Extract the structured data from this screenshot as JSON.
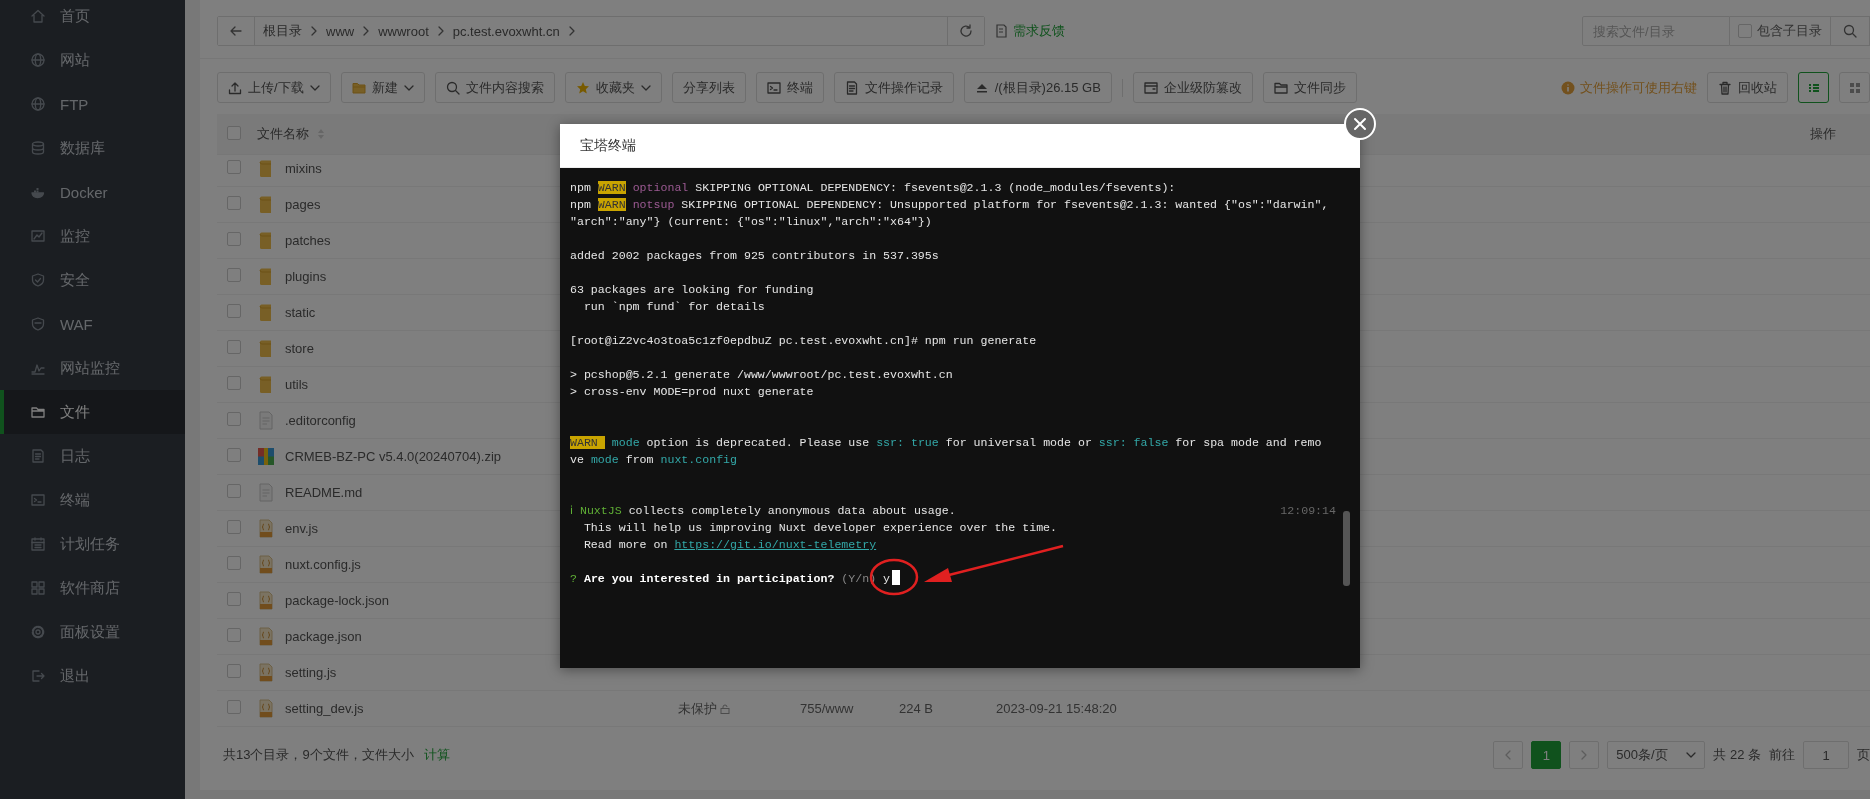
{
  "sidebar": {
    "items": [
      {
        "label": "首页",
        "selected": false
      },
      {
        "label": "网站",
        "selected": false
      },
      {
        "label": "FTP",
        "selected": false
      },
      {
        "label": "数据库",
        "selected": false
      },
      {
        "label": "Docker",
        "selected": false
      },
      {
        "label": "监控",
        "selected": false
      },
      {
        "label": "安全",
        "selected": false
      },
      {
        "label": "WAF",
        "selected": false
      },
      {
        "label": "网站监控",
        "selected": false
      },
      {
        "label": "文件",
        "selected": true
      },
      {
        "label": "日志",
        "selected": false
      },
      {
        "label": "终端",
        "selected": false
      },
      {
        "label": "计划任务",
        "selected": false
      },
      {
        "label": "软件商店",
        "selected": false
      },
      {
        "label": "面板设置",
        "selected": false
      },
      {
        "label": "退出",
        "selected": false
      }
    ]
  },
  "breadcrumb": {
    "items": [
      "根目录",
      "www",
      "wwwroot",
      "pc.test.evoxwht.cn"
    ],
    "feedback": "需求反馈"
  },
  "search": {
    "placeholder": "搜索文件/目录",
    "subdir_label": "包含子目录",
    "subdir_checked": false
  },
  "toolbar": {
    "buttons": [
      {
        "label": "上传/下载",
        "kind": "dropdown"
      },
      {
        "label": "新建",
        "kind": "dropdown"
      },
      {
        "label": "文件内容搜索",
        "kind": "plain"
      },
      {
        "label": "收藏夹",
        "kind": "dropdown"
      },
      {
        "label": "分享列表",
        "kind": "plain"
      },
      {
        "label": "终端",
        "kind": "plain"
      },
      {
        "label": "文件操作记录",
        "kind": "plain"
      },
      {
        "label": "/(根目录)26.15 GB",
        "kind": "disk"
      },
      {
        "label": "企业级防篡改",
        "kind": "plain"
      },
      {
        "label": "文件同步",
        "kind": "plain"
      }
    ],
    "hint": "文件操作可使用右键",
    "recycle": "回收站",
    "views": [
      {
        "selected": true
      },
      {
        "selected": false
      }
    ]
  },
  "table": {
    "columns": [
      "文件名称",
      "操作"
    ],
    "header_checked": false,
    "rows": [
      {
        "name": "mixins",
        "kind": "folder",
        "checked": false
      },
      {
        "name": "pages",
        "kind": "folder",
        "checked": false
      },
      {
        "name": "patches",
        "kind": "folder",
        "checked": false
      },
      {
        "name": "plugins",
        "kind": "folder",
        "checked": false
      },
      {
        "name": "static",
        "kind": "folder",
        "checked": false
      },
      {
        "name": "store",
        "kind": "folder",
        "checked": false
      },
      {
        "name": "utils",
        "kind": "folder",
        "checked": false
      },
      {
        "name": ".editorconfig",
        "kind": "file",
        "checked": false
      },
      {
        "name": "CRMEB-BZ-PC v5.4.0(20240704).zip",
        "kind": "archive",
        "checked": false
      },
      {
        "name": "README.md",
        "kind": "file",
        "checked": false
      },
      {
        "name": "env.js",
        "kind": "script",
        "checked": false
      },
      {
        "name": "nuxt.config.js",
        "kind": "script",
        "checked": false
      },
      {
        "name": "package-lock.json",
        "kind": "script",
        "checked": false
      },
      {
        "name": "package.json",
        "kind": "script",
        "checked": false
      },
      {
        "name": "setting.js",
        "kind": "script",
        "checked": false
      },
      {
        "name": "setting_dev.js",
        "kind": "script",
        "checked": false,
        "protection": "未保护",
        "permission": "755/www",
        "size": "224 B",
        "modified": "2023-09-21 15:48:20"
      }
    ]
  },
  "footer": {
    "summary": "共13个目录，9个文件，文件大小",
    "calc": "计算"
  },
  "pagination": {
    "pages": [
      {
        "label": "1",
        "selected": true
      }
    ],
    "page_size": "500条/页",
    "total": "共 22 条",
    "goto_label": "前往",
    "goto_value": "1",
    "page_unit": "页"
  },
  "modal": {
    "title": "宝塔终端",
    "cursor_visible": true,
    "lines": [
      {
        "kind": "text",
        "segments": [
          {
            "text": "npm ",
            "kind": "plain"
          },
          {
            "text": "WARN",
            "kind": "badge"
          },
          {
            "text": " optional",
            "kind": "dim"
          },
          {
            "text": " SKIPPING OPTIONAL DEPENDENCY: fsevents@2.1.3 (node_modules/fsevents):",
            "kind": "plain"
          }
        ]
      },
      {
        "kind": "text",
        "segments": [
          {
            "text": "npm ",
            "kind": "plain"
          },
          {
            "text": "WARN",
            "kind": "badge"
          },
          {
            "text": " notsup",
            "kind": "dim"
          },
          {
            "text": " SKIPPING OPTIONAL DEPENDENCY: Unsupported platform for fsevents@2.1.3: wanted {\"os\":\"darwin\",",
            "kind": "plain"
          }
        ]
      },
      {
        "kind": "text",
        "segments": [
          {
            "text": "\"arch\":\"any\"} (current: {\"os\":\"linux\",\"arch\":\"x64\"})",
            "kind": "plain"
          }
        ]
      },
      {
        "kind": "blank"
      },
      {
        "kind": "text",
        "segments": [
          {
            "text": "added 2002 packages from 925 contributors in 537.395s",
            "kind": "plain"
          }
        ]
      },
      {
        "kind": "blank"
      },
      {
        "kind": "text",
        "segments": [
          {
            "text": "63 packages are looking for funding",
            "kind": "plain"
          }
        ]
      },
      {
        "kind": "text",
        "segments": [
          {
            "text": "  run `npm fund` for details",
            "kind": "plain"
          }
        ]
      },
      {
        "kind": "blank"
      },
      {
        "kind": "text",
        "segments": [
          {
            "text": "[root@iZ2vc4o3toa5c1zf0epdbuZ pc.test.evoxwht.cn]# npm run generate",
            "kind": "plain"
          }
        ]
      },
      {
        "kind": "blank"
      },
      {
        "kind": "text",
        "segments": [
          {
            "text": "> pcshop@5.2.1 generate /www/wwwroot/pc.test.evoxwht.cn",
            "kind": "plain"
          }
        ]
      },
      {
        "kind": "text",
        "segments": [
          {
            "text": "> cross-env MODE=prod nuxt generate",
            "kind": "plain"
          }
        ]
      },
      {
        "kind": "blank"
      },
      {
        "kind": "blank"
      },
      {
        "kind": "text",
        "segments": [
          {
            "text": "WARN ",
            "kind": "badge"
          },
          {
            "text": " mode",
            "kind": "accent"
          },
          {
            "text": " option is deprecated. Please use ",
            "kind": "plain"
          },
          {
            "text": "ssr: true",
            "kind": "accent"
          },
          {
            "text": " for universal mode or ",
            "kind": "plain"
          },
          {
            "text": "ssr: false",
            "kind": "accent"
          },
          {
            "text": " for spa mode and remo",
            "kind": "plain"
          }
        ]
      },
      {
        "kind": "text",
        "segments": [
          {
            "text": "ve ",
            "kind": "plain"
          },
          {
            "text": "mode",
            "kind": "accent"
          },
          {
            "text": " from ",
            "kind": "plain"
          },
          {
            "text": "nuxt.config",
            "kind": "accent"
          }
        ]
      },
      {
        "kind": "blank"
      },
      {
        "kind": "blank"
      },
      {
        "kind": "text",
        "time": "12:09:14",
        "segments": [
          {
            "text": "ℹ NuxtJS",
            "kind": "green"
          },
          {
            "text": " collects completely anonymous data about usage.",
            "kind": "plain"
          }
        ]
      },
      {
        "kind": "text",
        "segments": [
          {
            "text": "  This will help us improving Nuxt developer experience over the time.",
            "kind": "plain"
          }
        ]
      },
      {
        "kind": "text",
        "segments": [
          {
            "text": "  Read more on ",
            "kind": "plain"
          },
          {
            "text": "https://git.io/nuxt-telemetry",
            "kind": "link"
          }
        ]
      },
      {
        "kind": "blank"
      },
      {
        "kind": "text",
        "segments": [
          {
            "text": "?",
            "kind": "green"
          },
          {
            "text": " Are you interested in participation?",
            "kind": "bold"
          },
          {
            "text": " (Y/n)",
            "kind": "muted"
          },
          {
            "text": " y",
            "kind": "plain"
          }
        ]
      }
    ]
  }
}
